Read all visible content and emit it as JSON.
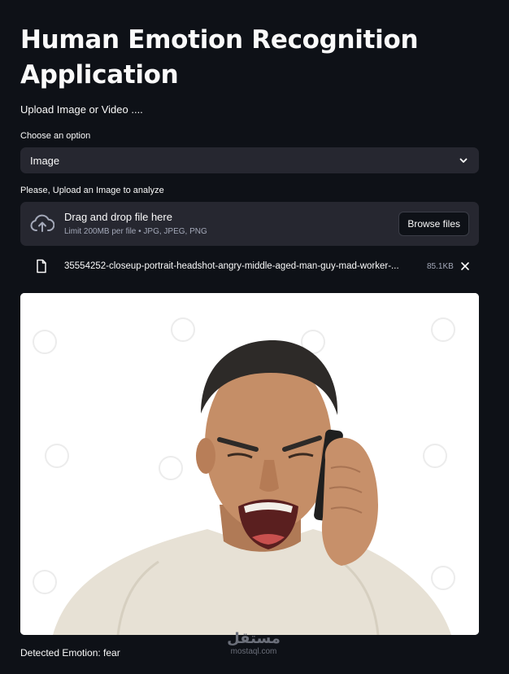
{
  "app": {
    "title": "Human Emotion Recognition Application",
    "subtitle": "Upload Image or Video ...."
  },
  "option_select": {
    "label": "Choose an option",
    "value": "Image"
  },
  "uploader": {
    "label": "Please, Upload an Image to analyze",
    "drag_text": "Drag and drop file here",
    "limit_text": "Limit 200MB per file • JPG, JPEG, PNG",
    "browse_label": "Browse files"
  },
  "uploaded_file": {
    "name": "35554252-closeup-portrait-headshot-angry-middle-aged-man-guy-mad-worker-...",
    "size": "85.1KB"
  },
  "result": {
    "text": "Detected Emotion: fear"
  },
  "watermark": {
    "arabic": "مستقل",
    "latin": "mostaql.com"
  },
  "colors": {
    "background": "#0e1117",
    "widget": "#262730",
    "text": "#fafafa",
    "muted": "#a3a8b8"
  },
  "icons": {
    "select": "chevron-down-icon",
    "dropzone": "cloud-upload-icon",
    "file": "file-icon",
    "remove": "close-icon"
  }
}
